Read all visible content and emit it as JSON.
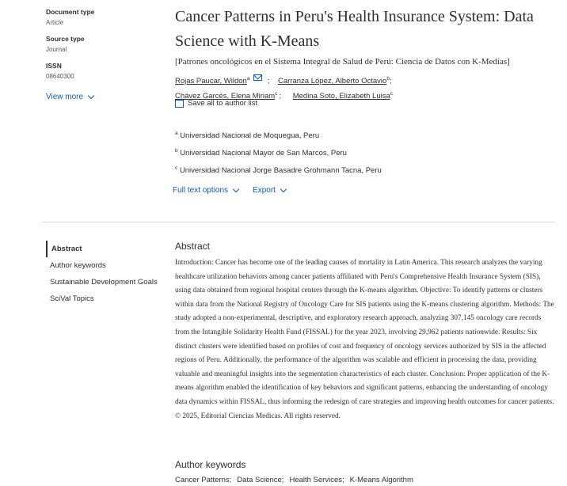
{
  "sidebar_meta": [
    {
      "label": "Document type",
      "value": "Article"
    },
    {
      "label": "Source type",
      "value": "Journal"
    },
    {
      "label": "ISSN",
      "value": "08640300"
    }
  ],
  "view_more": "View more",
  "title": "Cancer Patterns in Peru's Health Insurance System: Data Science with K-Means",
  "subtitle": "[Patrones oncológicos en el Sistema Integral de Salud de Perú: Ciencia de Datos con K-Medias]",
  "authors": [
    {
      "name": "Rojas Paucar, Wildon",
      "sup": "a",
      "email": true,
      "sep": ";"
    },
    {
      "name": "Carranza López, Alberto Octavio",
      "sup": "b",
      "sep": ";"
    },
    {
      "name": "Chávez Garcés, Elena Miriam",
      "sup": "c",
      "sep": ";"
    },
    {
      "name": "Medina Soto, Elizabeth Luisa",
      "sup": "c",
      "sep": ""
    }
  ],
  "save_authors": "Save all to author list",
  "affiliations": [
    {
      "sup": "a",
      "text": "Universidad Nacional de Moquegua, Peru"
    },
    {
      "sup": "b",
      "text": "Universidad Nacional Mayor de San Marcos, Peru"
    },
    {
      "sup": "c",
      "text": "Universidad Nacional Jorge Basadre Grohmann Tacna, Peru"
    }
  ],
  "actions": {
    "full_text": "Full text options",
    "export": "Export"
  },
  "nav": [
    "Abstract",
    "Author keywords",
    "Sustainable Development Goals",
    "SciVal Topics"
  ],
  "abstract_heading": "Abstract",
  "abstract_text": "Introduction: Cancer has become one of the leading causes of mortality in Latin America. This research analyzes the varying healthcare utilization behaviors among cancer patients affiliated with Peru's Comprehensive Health Insurance System (SIS), using data obtained from regional hospital centers through the K-means algorithm. Objective: To identify patterns or clusters within data from the National Registry of Oncology Care for SIS patients using the K-means clustering algorithm. Methods: The study adopted a non-experimental, descriptive, and exploratory research approach, analyzing 307,145 oncology care records from the Intangible Solidarity Health Fund (FISSAL) for the year 2023, involving 29,962 patients nationwide. Results: Six distinct clusters were identified based on profiles of cost and frequency of oncology services authorized by SIS in the affected regions of Peru. Additionally, the performance of the algorithm was scalable and efficient in processing the data, providing valuable and meaningful insights into the segmentation characteristics of each cluster. Conclusion: Proper application of the K-means algorithm enabled the identification of key behaviors and significant patterns, enhancing the understanding of oncology data dynamics within FISSAL, thus informing the redesign of care strategies and improving health outcomes for cancer patients. © 2025, Editorial Ciencias Medicas. All rights reserved.",
  "keywords_heading": "Author keywords",
  "keywords": [
    "Cancer Patterns;",
    "Data Science;",
    "Health Services;",
    "K-Means Algorithm"
  ]
}
